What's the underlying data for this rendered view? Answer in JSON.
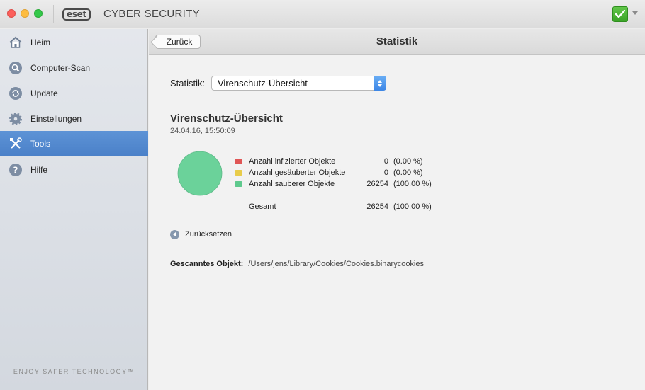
{
  "window": {
    "app_name": "CYBER SECURITY",
    "logo_text": "eset"
  },
  "sidebar": {
    "items": [
      {
        "label": "Heim",
        "icon": "home-icon",
        "active": false
      },
      {
        "label": "Computer-Scan",
        "icon": "magnifier-icon",
        "active": false
      },
      {
        "label": "Update",
        "icon": "refresh-icon",
        "active": false
      },
      {
        "label": "Einstellungen",
        "icon": "gear-icon",
        "active": false
      },
      {
        "label": "Tools",
        "icon": "tools-icon",
        "active": true
      },
      {
        "label": "Hilfe",
        "icon": "help-icon",
        "active": false
      }
    ],
    "tagline": "ENJOY SAFER TECHNOLOGY™"
  },
  "header": {
    "back_label": "Zurück",
    "title": "Statistik"
  },
  "main": {
    "select_label": "Statistik:",
    "select_value": "Virenschutz-Übersicht",
    "section_title": "Virenschutz-Übersicht",
    "timestamp": "24.04.16, 15:50:09",
    "legend": [
      {
        "label": "Anzahl infizierter Objekte",
        "count": "0",
        "percent": "(0.00 %)",
        "color": "#e05656"
      },
      {
        "label": "Anzahl gesäuberter Objekte",
        "count": "0",
        "percent": "(0.00 %)",
        "color": "#e8cc4a"
      },
      {
        "label": "Anzahl sauberer Objekte",
        "count": "26254",
        "percent": "(100.00 %)",
        "color": "#5ec98d"
      }
    ],
    "total": {
      "label": "Gesamt",
      "count": "26254",
      "percent": "(100.00 %)"
    },
    "reset_label": "Zurücksetzen",
    "scanned_label": "Gescanntes Objekt:",
    "scanned_path": "/Users/jens/Library/Cookies/Cookies.binarycookies"
  },
  "chart_data": {
    "type": "pie",
    "categories": [
      "Anzahl infizierter Objekte",
      "Anzahl gesäuberter Objekte",
      "Anzahl sauberer Objekte"
    ],
    "values": [
      0,
      0,
      26254
    ],
    "colors": [
      "#e05656",
      "#e8cc4a",
      "#6bd29a"
    ]
  }
}
